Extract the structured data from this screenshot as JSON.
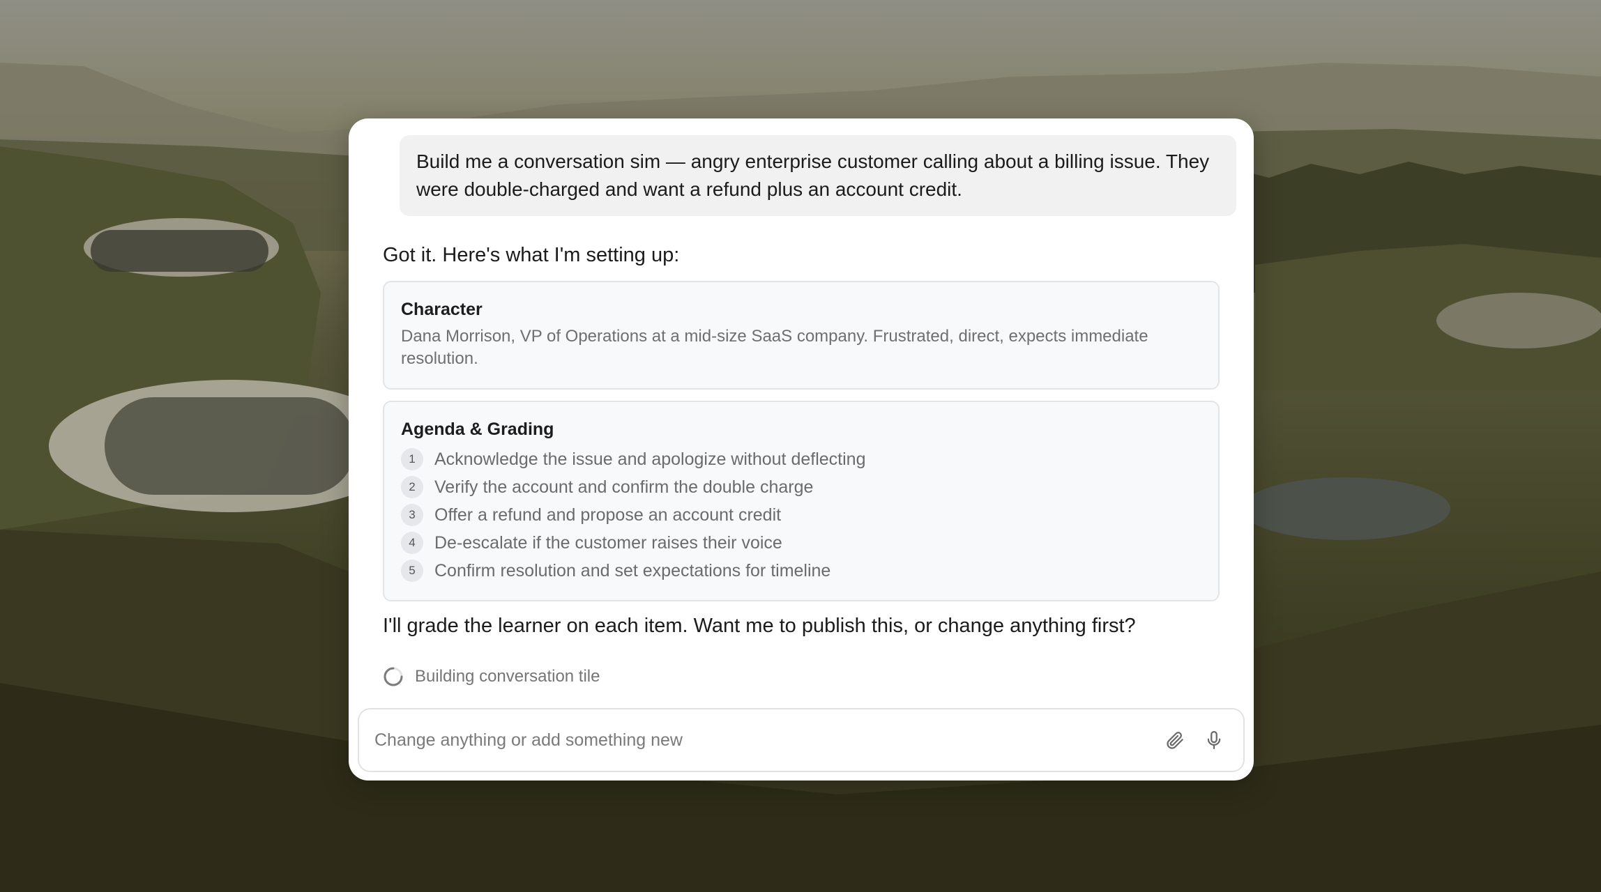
{
  "conversation": {
    "user_message": "Build me a conversation sim — angry enterprise customer calling about a billing issue. They were double-charged and want a refund plus an account credit.",
    "assistant_intro": "Got it. Here's what I'm setting up:",
    "character": {
      "title": "Character",
      "description": "Dana Morrison, VP of Operations at a mid-size SaaS company. Frustrated, direct, expects immediate resolution."
    },
    "agenda": {
      "title": "Agenda & Grading",
      "items": [
        {
          "number": "1",
          "text": "Acknowledge the issue and apologize without deflecting"
        },
        {
          "number": "2",
          "text": "Verify the account and confirm the double charge"
        },
        {
          "number": "3",
          "text": "Offer a refund and propose an account credit"
        },
        {
          "number": "4",
          "text": "De-escalate if the customer raises their voice"
        },
        {
          "number": "5",
          "text": "Confirm resolution and set expectations for timeline"
        }
      ]
    },
    "assistant_outro": "I'll grade the learner on each item. Want me to publish this, or change anything first?",
    "status": {
      "text": "Building conversation tile",
      "icon": "spinner-icon"
    }
  },
  "composer": {
    "placeholder": "Change anything or add something new",
    "value": "",
    "attach_icon": "paperclip-icon",
    "mic_icon": "microphone-icon"
  }
}
